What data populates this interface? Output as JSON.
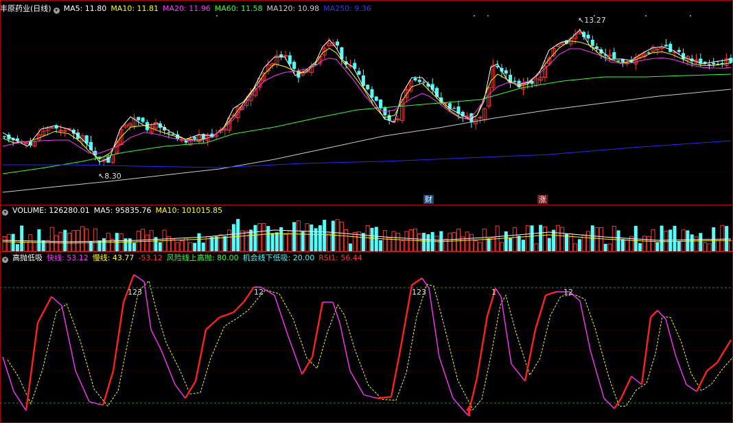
{
  "price_panel": {
    "stock_name": "丰原药业",
    "period": "(日线)",
    "indicators": [
      {
        "label": "MA5: 11.80",
        "color": "#ffffff"
      },
      {
        "label": "MA10: 11.81",
        "color": "#ffff00"
      },
      {
        "label": "MA20: 11.96",
        "color": "#ff33ff"
      },
      {
        "label": "MA60: 11.58",
        "color": "#33ff33"
      },
      {
        "label": "MA120: 10.98",
        "color": "#cccccc"
      },
      {
        "label": "MA250: 9.36",
        "color": "#3333ff"
      }
    ],
    "high_label": "13.27",
    "low_label": "8.30",
    "event_tag_1": "财",
    "event_tag_2": "涨"
  },
  "volume_panel": {
    "title": "VOLUME: 126280.01",
    "indicators": [
      {
        "label": "MA5: 95835.76",
        "color": "#ffffff"
      },
      {
        "label": "MA10: 101015.85",
        "color": "#ffff00"
      }
    ]
  },
  "indicator_panel": {
    "title": "高抛低吸",
    "indicators": [
      {
        "label": "快线: 53.12",
        "color": "#ff33ff"
      },
      {
        "label": "慢线: 43.77",
        "color": "#ffff00"
      },
      {
        "label": "-53.12",
        "color": "#ff3333"
      },
      {
        "label": "风险线上高抛: 80.00",
        "color": "#33ff33"
      },
      {
        "label": "机会线下低吸: 20.00",
        "color": "#33ffff"
      },
      {
        "label": "RSI1: 56.44",
        "color": "#ff3333"
      }
    ],
    "peak_labels": [
      "123",
      "12",
      "123",
      "1",
      "12"
    ]
  },
  "colors": {
    "up": "#ff3232",
    "down": "#54fcfc",
    "ma5": "#ffffff",
    "ma10": "#ffff00",
    "ma20": "#ff33ff",
    "ma60": "#33ff33",
    "ma120": "#cccccc",
    "ma250": "#2626ff",
    "panel_border": "#b00000"
  }
}
